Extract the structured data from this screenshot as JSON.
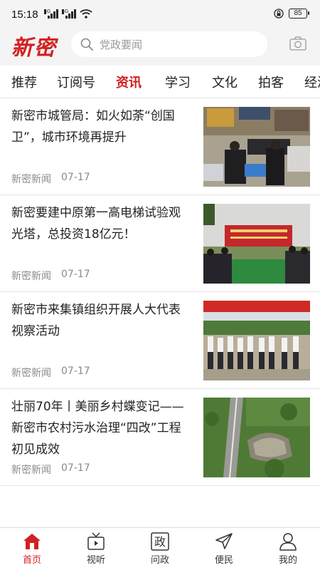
{
  "status_bar": {
    "time": "15:18",
    "signal_tag_1": "4G",
    "signal_tag_2": "4G",
    "battery": "85"
  },
  "header": {
    "logo": "新密",
    "search_placeholder": "党政要闻"
  },
  "tabs": [
    {
      "label": "推荐"
    },
    {
      "label": "订阅号"
    },
    {
      "label": "资讯",
      "active": true
    },
    {
      "label": "学习"
    },
    {
      "label": "文化"
    },
    {
      "label": "拍客"
    },
    {
      "label": "经济"
    }
  ],
  "news": [
    {
      "title": "新密市城管局：如火如荼“创国卫”，城市环境再提升",
      "source": "新密新闻",
      "date": "07-17"
    },
    {
      "title": "新密要建中原第一高电梯试验观光塔，总投资18亿元！",
      "source": "新密新闻",
      "date": "07-17"
    },
    {
      "title": "新密市来集镇组织开展人大代表视察活动",
      "source": "新密新闻",
      "date": "07-17"
    },
    {
      "title": "壮丽70年丨美丽乡村蝶变记——新密市农村污水治理“四改”工程初见成效",
      "source": "新密新闻",
      "date": "07-17"
    }
  ],
  "bottom_nav": [
    {
      "label": "首页",
      "icon": "home-icon",
      "active": true
    },
    {
      "label": "视听",
      "icon": "tv-icon"
    },
    {
      "label": "问政",
      "icon": "zheng-icon",
      "glyph": "政"
    },
    {
      "label": "便民",
      "icon": "send-icon"
    },
    {
      "label": "我的",
      "icon": "user-icon"
    }
  ],
  "colors": {
    "accent": "#d22121",
    "header_bg": "#f4f4f4",
    "muted_text": "#8a8a8a"
  }
}
